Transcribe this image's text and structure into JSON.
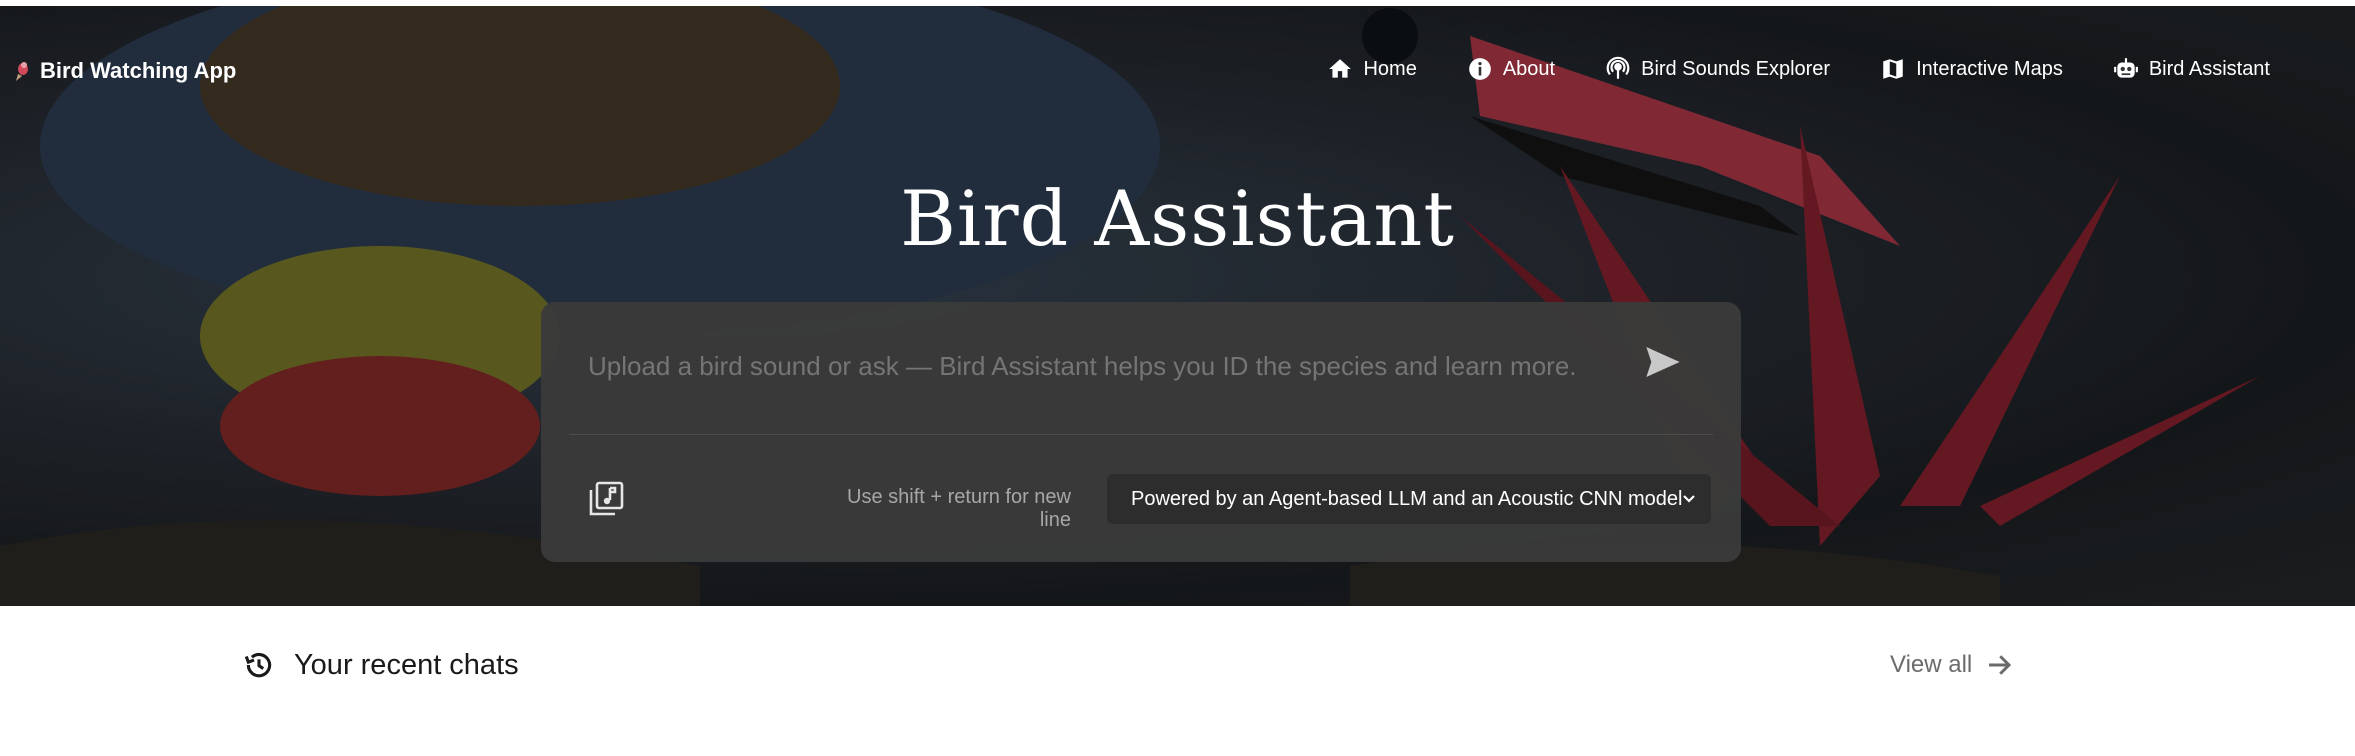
{
  "app": {
    "brand": "Bird Watching App"
  },
  "nav": {
    "items": [
      {
        "label": "Home",
        "icon": "home-icon"
      },
      {
        "label": "About",
        "icon": "info-icon"
      },
      {
        "label": "Bird Sounds Explorer",
        "icon": "podcast-icon"
      },
      {
        "label": "Interactive Maps",
        "icon": "map-icon"
      },
      {
        "label": "Bird Assistant",
        "icon": "robot-icon"
      }
    ]
  },
  "hero": {
    "title": "Bird Assistant"
  },
  "chat": {
    "placeholder": "Upload a bird sound or ask — Bird Assistant helps you ID the species and learn more.",
    "hint": "Use shift + return for new line",
    "model": "Powered by an Agent-based LLM and an Acoustic CNN model"
  },
  "recent": {
    "title": "Your recent chats",
    "view_all": "View all"
  },
  "colors": {
    "panel": "#3a3a3a",
    "select": "#2d2d2d",
    "text_muted": "#a7a7a7"
  }
}
